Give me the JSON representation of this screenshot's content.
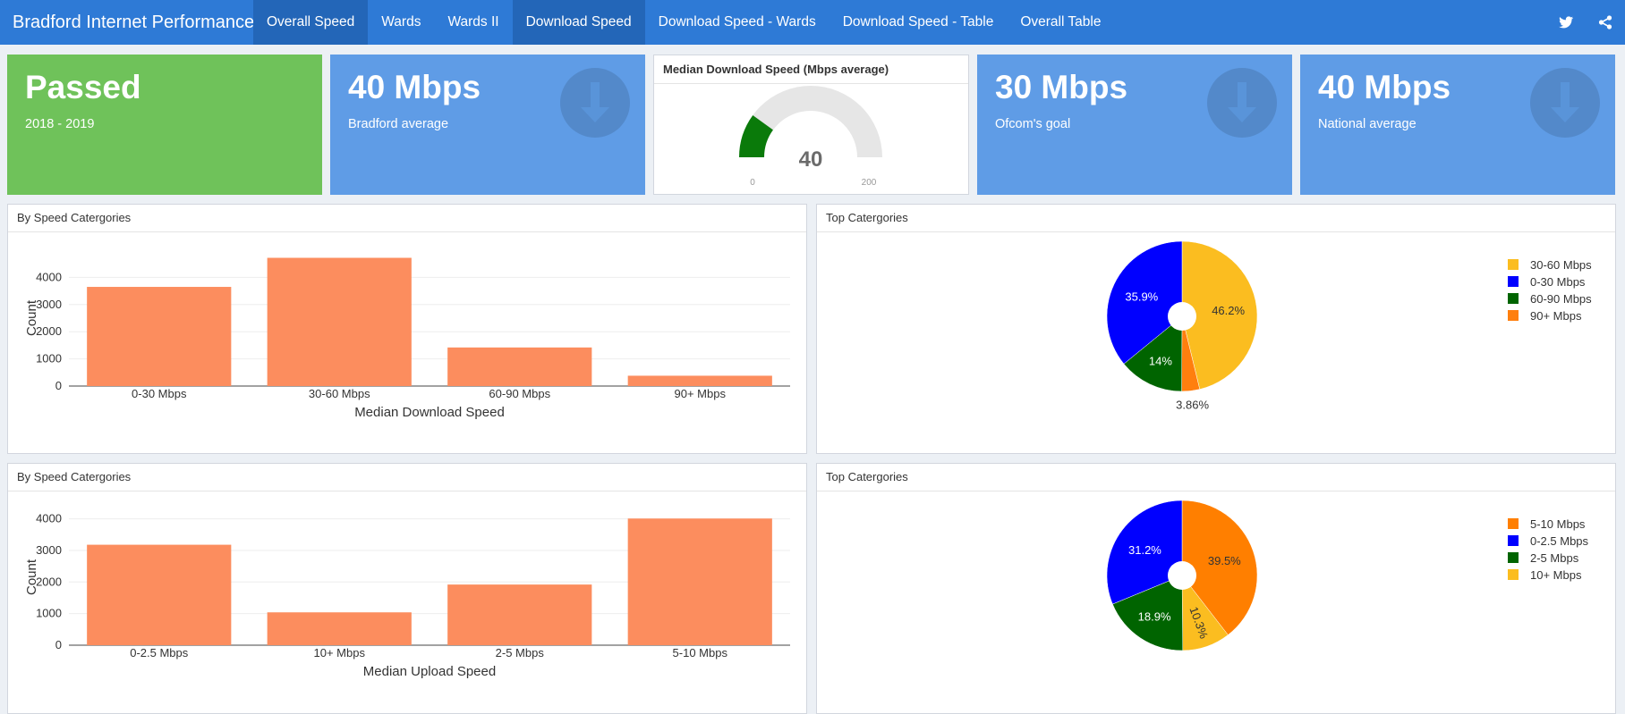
{
  "app": {
    "title": "Bradford Internet Performance"
  },
  "nav": {
    "items": [
      {
        "label": "Overall Speed",
        "active": true
      },
      {
        "label": "Wards",
        "active": false
      },
      {
        "label": "Wards II",
        "active": false
      },
      {
        "label": "Download Speed",
        "active": true
      },
      {
        "label": "Download Speed - Wards",
        "active": false
      },
      {
        "label": "Download Speed - Table",
        "active": false
      },
      {
        "label": "Overall Table",
        "active": false
      }
    ],
    "icons": [
      "twitter-icon",
      "share-icon"
    ]
  },
  "value_boxes": [
    {
      "value": "Passed",
      "subtitle": "2018 - 2019",
      "color": "#6fc25a",
      "icon": ""
    },
    {
      "value": "40 Mbps",
      "subtitle": "Bradford average",
      "color": "#5f9ce6",
      "icon": "arrow-down-icon"
    },
    {
      "value": "30 Mbps",
      "subtitle": "Ofcom's goal",
      "color": "#5f9ce6",
      "icon": "arrow-down-icon"
    },
    {
      "value": "40 Mbps",
      "subtitle": "National average",
      "color": "#5f9ce6",
      "icon": "arrow-down-icon"
    }
  ],
  "gauge": {
    "title": "Median Download Speed (Mbps average)",
    "value": 40,
    "value_label": "40",
    "min": 0,
    "max": 200,
    "min_label": "0",
    "max_label": "200",
    "fill_color": "#0a7a0a",
    "track_color": "#e6e6e6"
  },
  "panels": {
    "download_bar_title": "By Speed Catergories",
    "download_pie_title": "Top Catergories",
    "upload_bar_title": "By Speed Catergories",
    "upload_pie_title": "Top Catergories"
  },
  "chart_data": [
    {
      "type": "bar",
      "categories": [
        "0-30 Mbps",
        "30-60 Mbps",
        "60-90 Mbps",
        "90+ Mbps"
      ],
      "values": [
        3650,
        4720,
        1420,
        380
      ],
      "xlabel": "Median Download Speed",
      "ylabel": "Count",
      "yticks": [
        0,
        1000,
        2000,
        3000,
        4000
      ],
      "ylim": [
        0,
        5000
      ],
      "bar_color": "#fc8d5e"
    },
    {
      "type": "pie",
      "hole": true,
      "slices": [
        {
          "label": "30-60 Mbps",
          "value": 46.2,
          "text": "46.2%",
          "color": "#fbbd20"
        },
        {
          "label": "90+ Mbps",
          "value": 3.86,
          "text": "3.86%",
          "color": "#ff7f0e"
        },
        {
          "label": "60-90 Mbps",
          "value": 14.0,
          "text": "14%",
          "color": "#006400"
        },
        {
          "label": "0-30 Mbps",
          "value": 35.9,
          "text": "35.9%",
          "color": "#0000ff"
        }
      ],
      "legend": [
        "30-60 Mbps",
        "0-30 Mbps",
        "60-90 Mbps",
        "90+ Mbps"
      ]
    },
    {
      "type": "bar",
      "categories": [
        "0-2.5 Mbps",
        "10+ Mbps",
        "2-5 Mbps",
        "5-10 Mbps"
      ],
      "values": [
        3180,
        1040,
        1920,
        4010
      ],
      "xlabel": "Median Upload Speed",
      "ylabel": "Count",
      "yticks": [
        0,
        1000,
        2000,
        3000,
        4000
      ],
      "ylim": [
        0,
        4300
      ],
      "bar_color": "#fc8d5e"
    },
    {
      "type": "pie",
      "hole": true,
      "slices": [
        {
          "label": "5-10 Mbps",
          "value": 39.5,
          "text": "39.5%",
          "color": "#ff7f00"
        },
        {
          "label": "10+ Mbps",
          "value": 10.3,
          "text": "10.3%",
          "color": "#fbbd20"
        },
        {
          "label": "2-5 Mbps",
          "value": 18.9,
          "text": "18.9%",
          "color": "#006400"
        },
        {
          "label": "0-2.5 Mbps",
          "value": 31.2,
          "text": "31.2%",
          "color": "#0000ff"
        }
      ],
      "legend": [
        "5-10 Mbps",
        "0-2.5 Mbps",
        "2-5 Mbps",
        "10+ Mbps"
      ]
    }
  ]
}
